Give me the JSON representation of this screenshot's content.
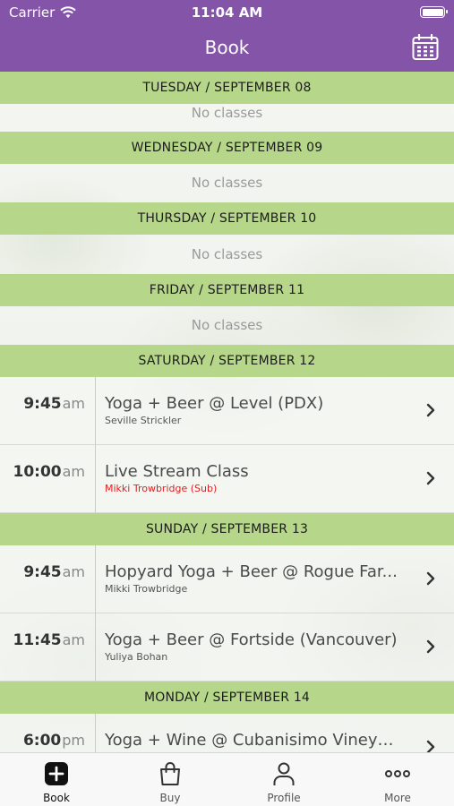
{
  "status_bar": {
    "carrier": "Carrier",
    "time": "11:04 AM"
  },
  "nav": {
    "title": "Book",
    "calendar_icon": "calendar-icon"
  },
  "days": [
    {
      "header": "TUESDAY / SEPTEMBER 08",
      "empty": "No classes"
    },
    {
      "header": "WEDNESDAY / SEPTEMBER 09",
      "empty": "No classes"
    },
    {
      "header": "THURSDAY / SEPTEMBER 10",
      "empty": "No classes"
    },
    {
      "header": "FRIDAY / SEPTEMBER 11",
      "empty": "No classes"
    },
    {
      "header": "SATURDAY / SEPTEMBER 12",
      "classes": [
        {
          "time": "9:45",
          "ampm": "am",
          "name": "Yoga + Beer @ Level (PDX)",
          "teacher": "Seville Strickler"
        },
        {
          "time": "10:00",
          "ampm": "am",
          "name": "Live Stream Class",
          "teacher": "Mikki Trowbridge (Sub)"
        }
      ]
    },
    {
      "header": "SUNDAY / SEPTEMBER 13",
      "classes": [
        {
          "time": "9:45",
          "ampm": "am",
          "name": "Hopyard Yoga + Beer @ Rogue Far...",
          "teacher": "Mikki Trowbridge"
        },
        {
          "time": "11:45",
          "ampm": "am",
          "name": "Yoga + Beer @ Fortside (Vancouver)",
          "teacher": "Yuliya Bohan"
        }
      ]
    },
    {
      "header": "MONDAY / SEPTEMBER 14",
      "classes": [
        {
          "time": "6:00",
          "ampm": "pm",
          "name": "Yoga + Wine @ Cubanisimo Vineya...",
          "teacher": ""
        }
      ]
    }
  ],
  "tabs": [
    {
      "label": "Book",
      "icon": "plus-square-icon",
      "active": true
    },
    {
      "label": "Buy",
      "icon": "shopping-bag-icon",
      "active": false
    },
    {
      "label": "Profile",
      "icon": "person-icon",
      "active": false
    },
    {
      "label": "More",
      "icon": "ellipsis-icon",
      "active": false
    }
  ],
  "colors": {
    "brand": "#8454a8",
    "day_header": "#b6d68a",
    "sub_teacher": "#e02020"
  }
}
